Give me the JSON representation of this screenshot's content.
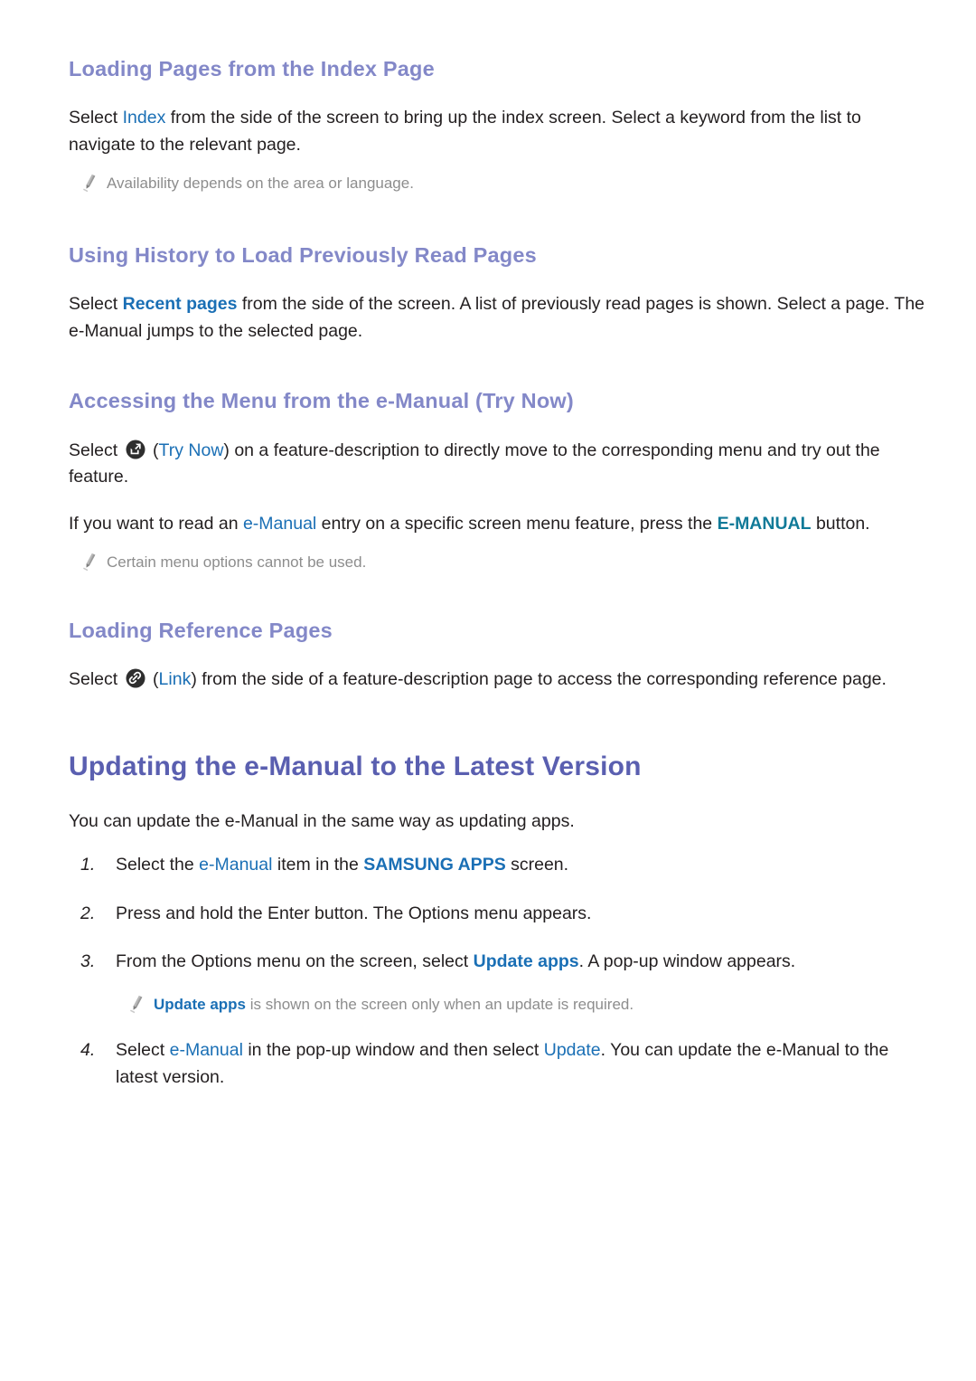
{
  "sections": [
    {
      "heading": "Loading Pages from the Index Page",
      "paragraph_pre": "Select ",
      "link1": "Index",
      "paragraph_post": " from the side of the screen to bring up the index screen. Select a keyword from the list to navigate to the relevant page.",
      "note": "Availability depends on the area or language."
    },
    {
      "heading": "Using History to Load Previously Read Pages",
      "paragraph_pre": "Select ",
      "link1": "Recent pages",
      "paragraph_post": " from the side of the screen. A list of previously read pages is shown. Select a page. The e-Manual jumps to the selected page."
    },
    {
      "heading": "Accessing the Menu from the e-Manual (Try Now)",
      "p1_pre": "Select ",
      "p1_icon": "try-now-icon",
      "p1_mid": " (",
      "p1_link": "Try Now",
      "p1_post": ") on a feature-description to directly move to the corresponding menu and try out the feature.",
      "p2_pre": "If you want to read an ",
      "p2_link1": "e-Manual",
      "p2_mid": " entry on a specific screen menu feature, press the ",
      "p2_link2": "E-MANUAL",
      "p2_post": " button.",
      "note": "Certain menu options cannot be used."
    },
    {
      "heading": "Loading Reference Pages",
      "p1_pre": "Select ",
      "p1_icon": "link-icon",
      "p1_mid": " (",
      "p1_link": "Link",
      "p1_post": ") from the side of a feature-description page to access the corresponding reference page."
    }
  ],
  "chapter": {
    "title": "Updating the e-Manual to the Latest Version",
    "intro": "You can update the e-Manual in the same way as updating apps.",
    "steps": [
      {
        "num": "1.",
        "pre": "Select the ",
        "link1": "e-Manual",
        "mid": " item in the ",
        "link2": "SAMSUNG APPS",
        "post": " screen."
      },
      {
        "num": "2.",
        "pre": "Press and hold the Enter button. The Options menu appears.",
        "link1": "",
        "mid": "",
        "link2": "",
        "post": ""
      },
      {
        "num": "3.",
        "pre": "From the Options menu on the screen, select ",
        "link1": "Update apps",
        "mid": ". A pop-up window appears.",
        "link2": "",
        "post": "",
        "note_link": "Update apps",
        "note_text": " is shown on the screen only when an update is required."
      },
      {
        "num": "4.",
        "pre": "Select ",
        "link1": "e-Manual",
        "mid": " in the pop-up window and then select ",
        "link2": "Update",
        "post": ". You can update the e-Manual to the latest version."
      }
    ]
  },
  "colors": {
    "section_heading": "#8388c8",
    "chapter_heading": "#5a5fb0",
    "link_blue": "#1a6fb5",
    "link_teal": "#107a98",
    "note_grey": "#8d8d8d",
    "body_text": "#231f20",
    "badge_dark": "#2e2e2e"
  },
  "icons": {
    "pencil": "pencil-icon",
    "try_now": "try-now-icon",
    "link": "link-icon"
  }
}
